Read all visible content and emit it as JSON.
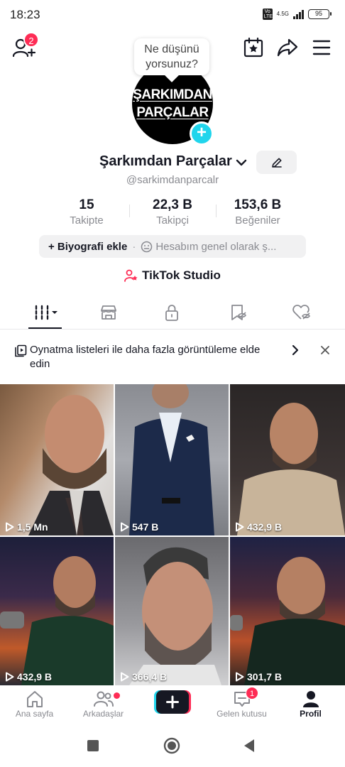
{
  "status_bar": {
    "time": "18:23",
    "volte": "Vo LTE",
    "network": "4.5G",
    "battery": "95"
  },
  "top_bar": {
    "notification_count": "2"
  },
  "tooltip": {
    "text_line1": "Ne düşünü",
    "text_line2": "yorsunuz?"
  },
  "profile": {
    "avatar_line1": "ŞARKIMDAN",
    "avatar_line2": "PARÇALAR",
    "display_name": "Şarkımdan Parçalar",
    "username": "@sarkimdanparcalr"
  },
  "stats": [
    {
      "value": "15",
      "label": "Takipte"
    },
    {
      "value": "22,3 B",
      "label": "Takipçi"
    },
    {
      "value": "153,6 B",
      "label": "Beğeniler"
    }
  ],
  "bio": {
    "add_label": "+ Biyografi ekle",
    "dot": "·",
    "privacy_text": "Hesabım genel olarak ş..."
  },
  "studio": {
    "label": "TikTok Studio"
  },
  "banner": {
    "text": "Oynatma listeleri ile daha fazla görüntüleme elde edin"
  },
  "videos": [
    {
      "views": "1,5 Mn"
    },
    {
      "views": "547 B"
    },
    {
      "views": "432,9 B"
    },
    {
      "views": "432,9 B"
    },
    {
      "views": "366,4 B"
    },
    {
      "views": "301,7 B"
    }
  ],
  "bottom_nav": {
    "home": "Ana sayfa",
    "friends": "Arkadaşlar",
    "inbox": "Gelen kutusu",
    "inbox_badge": "1",
    "profile": "Profil"
  },
  "colors": {
    "accent_red": "#fe2c55",
    "accent_cyan": "#20d5ec",
    "text_primary": "#161823",
    "text_secondary": "#8a8b91"
  }
}
